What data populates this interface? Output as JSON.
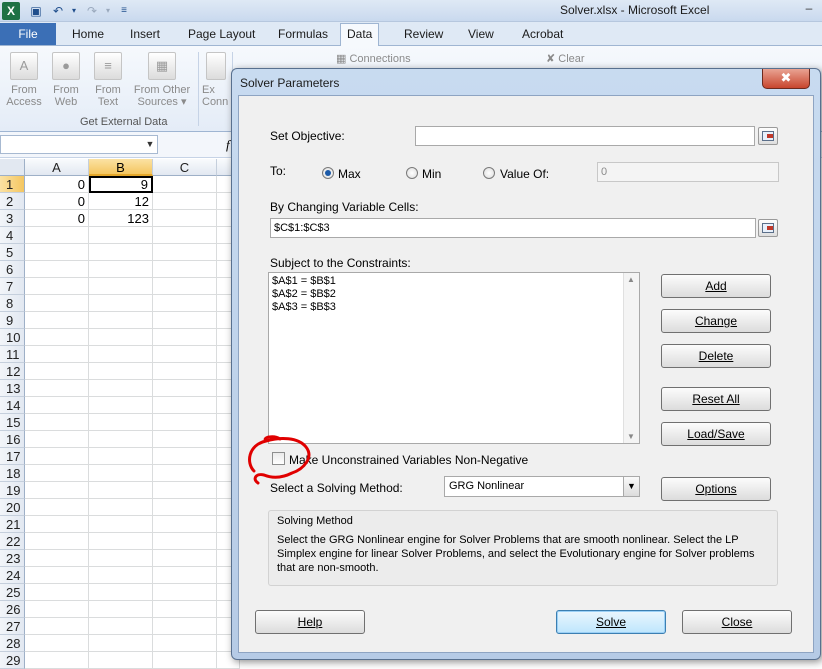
{
  "window": {
    "title": "Solver.xlsx  -  Microsoft Excel"
  },
  "ribbon": {
    "tabs": [
      {
        "label": "File"
      },
      {
        "label": "Home"
      },
      {
        "label": "Insert"
      },
      {
        "label": "Page Layout"
      },
      {
        "label": "Formulas"
      },
      {
        "label": "Data"
      },
      {
        "label": "Review"
      },
      {
        "label": "View"
      },
      {
        "label": "Acrobat"
      }
    ],
    "active_tab": "Data",
    "get_external_data": {
      "group_label": "Get External Data",
      "buttons": [
        {
          "line1": "From",
          "line2": "Access"
        },
        {
          "line1": "From",
          "line2": "Web"
        },
        {
          "line1": "From",
          "line2": "Text"
        },
        {
          "line1": "From Other",
          "line2": "Sources ▾"
        }
      ]
    },
    "partial_button": {
      "line1": "Ex",
      "line2": "Conn"
    },
    "connections_label": "Connections",
    "clear_label": "Clear"
  },
  "sheet": {
    "columns": [
      "A",
      "B",
      "C"
    ],
    "rows": [
      "1",
      "2",
      "3",
      "4",
      "5",
      "6",
      "7",
      "8",
      "9",
      "10",
      "11",
      "12",
      "13",
      "14",
      "15",
      "16",
      "17",
      "18",
      "19",
      "20",
      "21",
      "22",
      "23",
      "24",
      "25",
      "26",
      "27",
      "28",
      "29"
    ],
    "data": [
      {
        "a": "0",
        "b": "9"
      },
      {
        "a": "0",
        "b": "12"
      },
      {
        "a": "0",
        "b": "123"
      }
    ],
    "partial_formula_marker": "f"
  },
  "dialog": {
    "title": "Solver Parameters",
    "close_glyph": "✖",
    "set_objective": {
      "label": "Set Objective:",
      "value": ""
    },
    "to": {
      "label": "To:",
      "options": [
        {
          "label": "Max",
          "selected": true
        },
        {
          "label": "Min",
          "selected": false
        },
        {
          "label": "Value Of:",
          "selected": false
        }
      ],
      "value_of": "0"
    },
    "changing_cells": {
      "label": "By Changing Variable Cells:",
      "value": "$C$1:$C$3"
    },
    "constraints": {
      "label": "Subject to the Constraints:",
      "items": [
        "$A$1 = $B$1",
        "$A$2 = $B$2",
        "$A$3 = $B$3"
      ]
    },
    "buttons": {
      "add": "Add",
      "change": "Change",
      "delete": "Delete",
      "reset_all": "Reset All",
      "load_save": "Load/Save",
      "options": "Options",
      "help": "Help",
      "solve": "Solve",
      "close": "Close"
    },
    "non_negative": {
      "label": "Make Unconstrained Variables Non-Negative",
      "checked": false
    },
    "solving_method": {
      "label": "Select a Solving Method:",
      "value": "GRG Nonlinear"
    },
    "method_box": {
      "title": "Solving Method",
      "description": "Select the GRG Nonlinear engine for Solver Problems that are smooth nonlinear. Select the LP Simplex engine for linear Solver Problems, and select the Evolutionary engine for Solver problems that are non-smooth."
    },
    "annotation_color": "#e00000"
  }
}
